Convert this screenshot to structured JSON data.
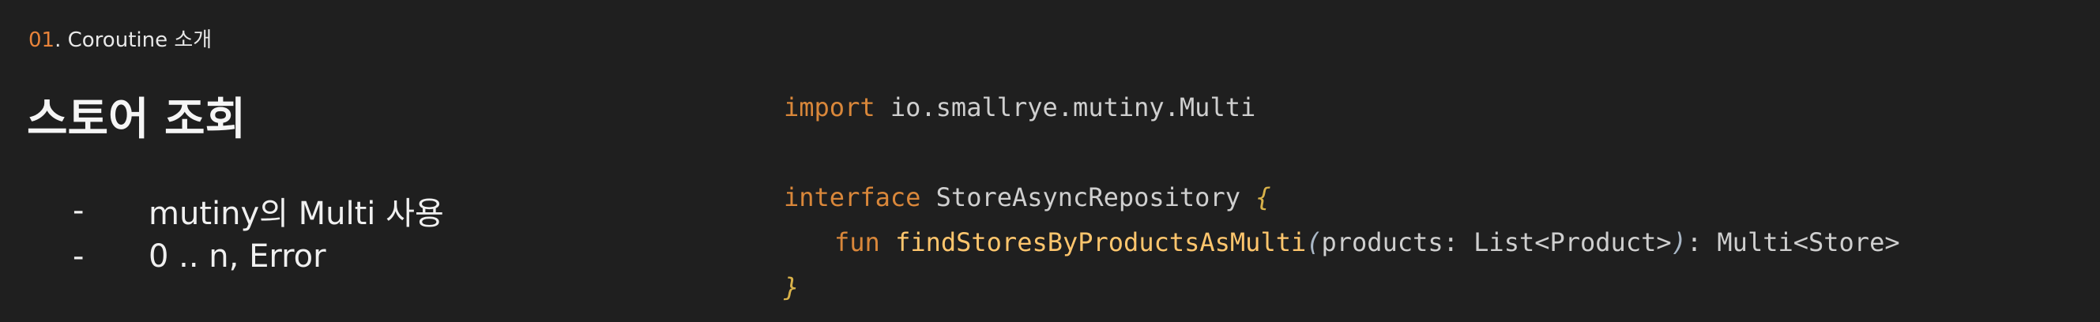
{
  "header": {
    "section_number": "01",
    "section_title": ". Coroutine 소개"
  },
  "title": "스토어 조회",
  "bullets": [
    {
      "dash": "-",
      "text": "mutiny의 Multi 사용"
    },
    {
      "dash": "-",
      "text": "0 .. n, Error"
    }
  ],
  "code": {
    "import_kw": "import",
    "import_path": " io.smallrye.mutiny.Multi",
    "interface_kw": "interface",
    "interface_name": " StoreAsyncRepository ",
    "open_brace": "{",
    "fun_kw": "fun",
    "fun_name": " findStoresByProductsAsMulti",
    "open_paren": "(",
    "params": "products: List<Product>",
    "close_paren": ")",
    "return_type": ": Multi<Store>",
    "close_brace": "}"
  },
  "colors": {
    "background": "#1f1f1f",
    "accent": "#e8833a",
    "keyword": "#d9873a",
    "function": "#ffc66d"
  }
}
